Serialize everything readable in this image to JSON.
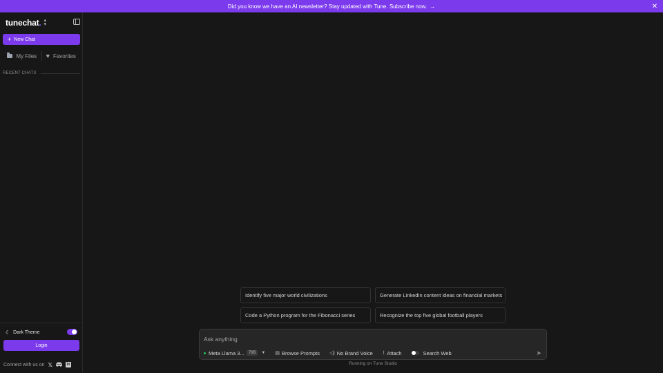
{
  "banner": {
    "text": "Did you know we have an AI newsletter? Stay updated with Tune. Subscribe now.",
    "arrow": "→",
    "close": "✕"
  },
  "sidebar": {
    "logo_main": "tunechat",
    "logo_dot": ".",
    "new_chat": "New Chat",
    "my_files": "My Files",
    "favorites": "Favorites",
    "recent_chats": "RECENT CHATS",
    "dark_theme": "Dark Theme",
    "login": "Login",
    "connect": "Connect with us on",
    "social_x": "𝕏"
  },
  "suggestions": [
    "Identify five major world civilizations",
    "Generate LinkedIn content ideas on financial markets",
    "Code a Python program for the Fibonacci series",
    "Recognize the top five global football players"
  ],
  "composer": {
    "placeholder": "Ask anything",
    "model": "Meta Llama 3...",
    "model_badge": "70B",
    "browse_prompts": "Browse Prompts",
    "brand_voice": "No Brand Voice",
    "attach": "Attach",
    "search_web": "Search Web"
  },
  "footer": {
    "running": "Running on Tune Studio"
  },
  "colors": {
    "accent": "#7c3aed",
    "background": "#171717",
    "composer_bg": "#262626"
  },
  "icons": [
    "arrow-right-icon",
    "close-icon",
    "chevron-updown-icon",
    "sidebar-collapse-icon",
    "plus-icon",
    "folder-icon",
    "heart-icon",
    "moon-icon",
    "x-icon",
    "discord-icon",
    "linkedin-icon",
    "document-icon",
    "voice-icon",
    "paperclip-icon",
    "send-icon"
  ]
}
